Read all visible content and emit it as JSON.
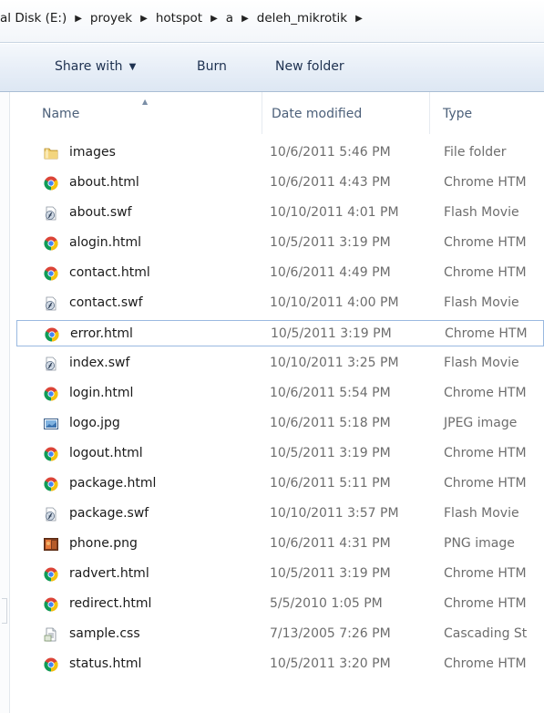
{
  "address": {
    "crumbs": [
      "al Disk (E:)",
      "proyek",
      "hotspot",
      "a",
      "deleh_mikrotik"
    ]
  },
  "toolbar": {
    "share_with": "Share with",
    "burn": "Burn",
    "new_folder": "New folder"
  },
  "columns": {
    "name": "Name",
    "date_modified": "Date modified",
    "type": "Type"
  },
  "files": [
    {
      "name": "images",
      "date": "10/6/2011 5:46 PM",
      "type": "File folder",
      "icon": "folder-icon"
    },
    {
      "name": "about.html",
      "date": "10/6/2011 4:43 PM",
      "type": "Chrome HTM",
      "icon": "chrome-icon"
    },
    {
      "name": "about.swf",
      "date": "10/10/2011 4:01 PM",
      "type": "Flash Movie",
      "icon": "flash-icon"
    },
    {
      "name": "alogin.html",
      "date": "10/5/2011 3:19 PM",
      "type": "Chrome HTM",
      "icon": "chrome-icon"
    },
    {
      "name": "contact.html",
      "date": "10/6/2011 4:49 PM",
      "type": "Chrome HTM",
      "icon": "chrome-icon"
    },
    {
      "name": "contact.swf",
      "date": "10/10/2011 4:00 PM",
      "type": "Flash Movie",
      "icon": "flash-icon"
    },
    {
      "name": "error.html",
      "date": "10/5/2011 3:19 PM",
      "type": "Chrome HTM",
      "icon": "chrome-icon",
      "focused": true
    },
    {
      "name": "index.swf",
      "date": "10/10/2011 3:25 PM",
      "type": "Flash Movie",
      "icon": "flash-icon"
    },
    {
      "name": "login.html",
      "date": "10/6/2011 5:54 PM",
      "type": "Chrome HTM",
      "icon": "chrome-icon"
    },
    {
      "name": "logo.jpg",
      "date": "10/6/2011 5:18 PM",
      "type": "JPEG image",
      "icon": "jpeg-image-icon"
    },
    {
      "name": "logout.html",
      "date": "10/5/2011 3:19 PM",
      "type": "Chrome HTM",
      "icon": "chrome-icon"
    },
    {
      "name": "package.html",
      "date": "10/6/2011 5:11 PM",
      "type": "Chrome HTM",
      "icon": "chrome-icon"
    },
    {
      "name": "package.swf",
      "date": "10/10/2011 3:57 PM",
      "type": "Flash Movie",
      "icon": "flash-icon"
    },
    {
      "name": "phone.png",
      "date": "10/6/2011 4:31 PM",
      "type": "PNG image",
      "icon": "png-image-icon"
    },
    {
      "name": "radvert.html",
      "date": "10/5/2011 3:19 PM",
      "type": "Chrome HTM",
      "icon": "chrome-icon"
    },
    {
      "name": "redirect.html",
      "date": "5/5/2010 1:05 PM",
      "type": "Chrome HTM",
      "icon": "chrome-icon"
    },
    {
      "name": "sample.css",
      "date": "7/13/2005 7:26 PM",
      "type": "Cascading St",
      "icon": "css-file-icon"
    },
    {
      "name": "status.html",
      "date": "10/5/2011 3:20 PM",
      "type": "Chrome HTM",
      "icon": "chrome-icon"
    }
  ]
}
